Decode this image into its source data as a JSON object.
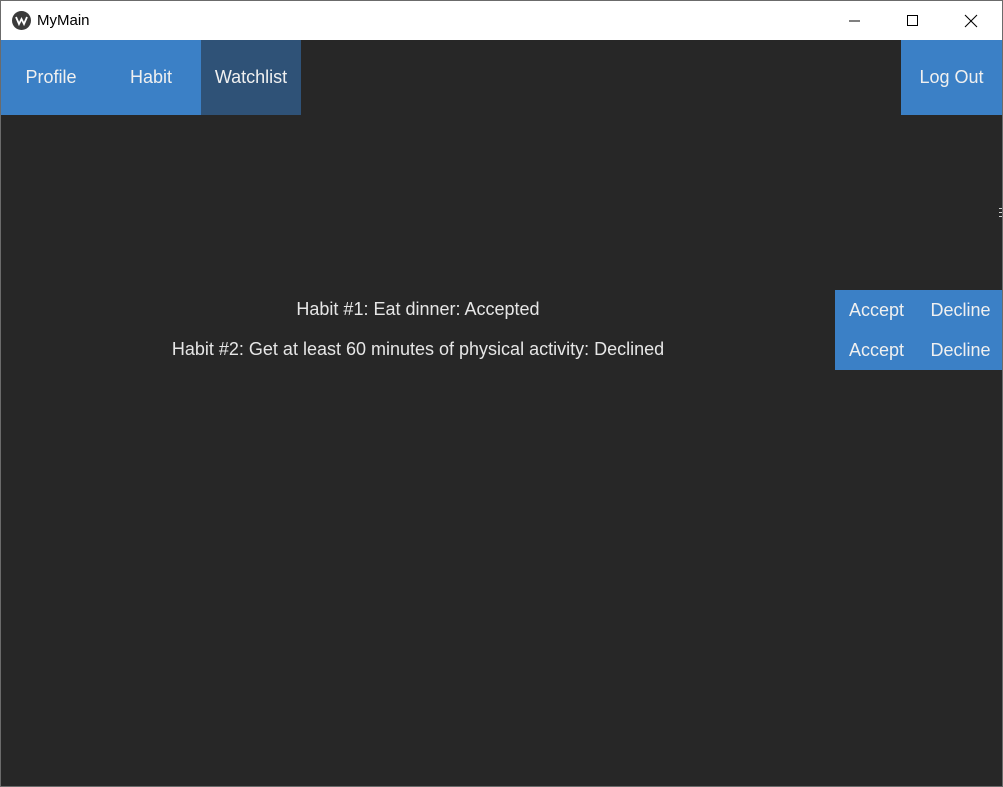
{
  "window": {
    "title": "MyMain",
    "icon": "kivy-app-icon",
    "controls": [
      "minimize-icon",
      "maximize-icon",
      "close-icon"
    ]
  },
  "navbar": {
    "profile": "Profile",
    "habit": "Habit",
    "watchlist": "Watchlist",
    "logout": "Log Out",
    "active": "Watchlist"
  },
  "habits": [
    {
      "text": "Habit #1: Eat dinner: Accepted",
      "accept_label": "Accept",
      "decline_label": "Decline"
    },
    {
      "text": "Habit #2: Get at least 60 minutes of physical activity: Declined",
      "accept_label": "Accept",
      "decline_label": "Decline"
    }
  ],
  "colors": {
    "background": "#272727",
    "accent": "#3b80c6",
    "active_tab": "#2f5277",
    "text": "#e6e6e6"
  }
}
